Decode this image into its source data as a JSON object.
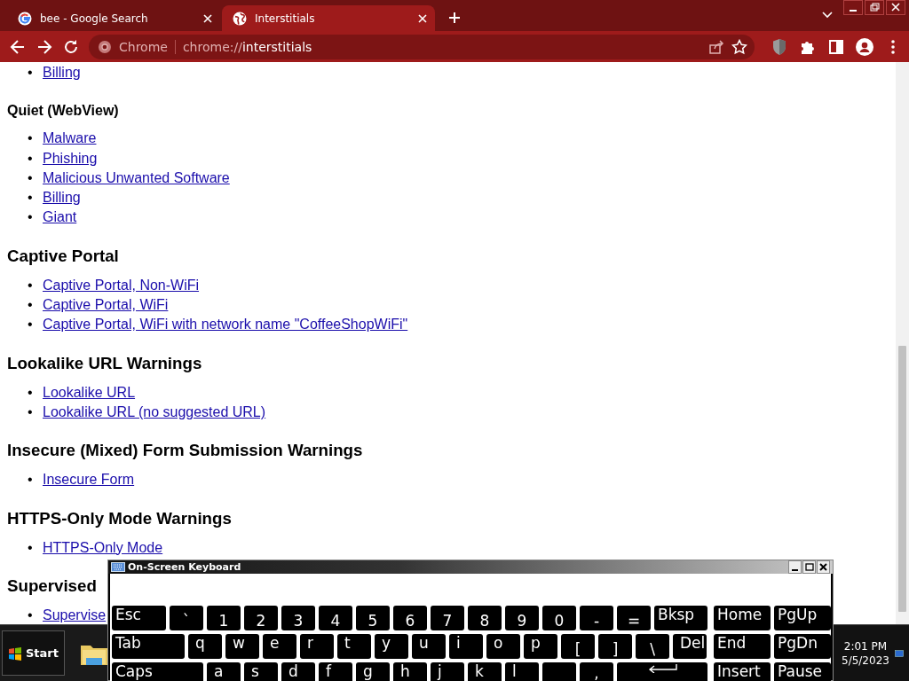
{
  "browser": {
    "tabs": [
      {
        "title": "bee - Google Search",
        "selected": false
      },
      {
        "title": "Interstitials",
        "selected": true
      }
    ],
    "address": {
      "site_label": "Chrome",
      "url_scheme": "chrome://",
      "url_path": "interstitials"
    }
  },
  "page": {
    "blocks": [
      {
        "kind": "list",
        "marker": "•",
        "items": [
          "Billing"
        ]
      },
      {
        "kind": "subheading",
        "text": "Quiet (WebView)"
      },
      {
        "kind": "list",
        "marker": "•",
        "items": [
          "Malware",
          "Phishing",
          "Malicious Unwanted Software",
          "Billing",
          "Giant"
        ]
      },
      {
        "kind": "heading",
        "text": "Captive Portal"
      },
      {
        "kind": "list",
        "marker": "•",
        "items": [
          "Captive Portal, Non-WiFi",
          "Captive Portal, WiFi",
          "Captive Portal, WiFi with network name \"CoffeeShopWiFi\""
        ]
      },
      {
        "kind": "heading",
        "text": "Lookalike URL Warnings"
      },
      {
        "kind": "list",
        "marker": "•",
        "items": [
          "Lookalike URL",
          "Lookalike URL (no suggested URL)"
        ]
      },
      {
        "kind": "heading",
        "text": "Insecure (Mixed) Form Submission Warnings"
      },
      {
        "kind": "list",
        "marker": "•",
        "items": [
          "Insecure Form"
        ]
      },
      {
        "kind": "heading",
        "text": "HTTPS-Only Mode Warnings"
      },
      {
        "kind": "list",
        "marker": "•",
        "items": [
          "HTTPS-Only Mode"
        ]
      },
      {
        "kind": "heading",
        "text": "Supervised"
      },
      {
        "kind": "list",
        "marker": "•",
        "items": [
          "Supervise"
        ]
      }
    ]
  },
  "keyboard": {
    "title": "On-Screen Keyboard",
    "rows": [
      [
        {
          "label": "Esc",
          "kind": "esc"
        },
        {
          "label": "`",
          "kind": "char"
        },
        {
          "label": "1",
          "kind": "char"
        },
        {
          "label": "2",
          "kind": "char"
        },
        {
          "label": "3",
          "kind": "char"
        },
        {
          "label": "4",
          "kind": "char"
        },
        {
          "label": "5",
          "kind": "char"
        },
        {
          "label": "6",
          "kind": "char"
        },
        {
          "label": "7",
          "kind": "char"
        },
        {
          "label": "8",
          "kind": "char"
        },
        {
          "label": "9",
          "kind": "char"
        },
        {
          "label": "0",
          "kind": "char"
        },
        {
          "label": "-",
          "kind": "char"
        },
        {
          "label": "=",
          "kind": "char"
        },
        {
          "label": "Bksp",
          "kind": "back"
        }
      ],
      [
        {
          "label": "Tab",
          "kind": "tab"
        },
        {
          "label": "q",
          "kind": "letter"
        },
        {
          "label": "w",
          "kind": "letter"
        },
        {
          "label": "e",
          "kind": "letter"
        },
        {
          "label": "r",
          "kind": "letter"
        },
        {
          "label": "t",
          "kind": "letter"
        },
        {
          "label": "y",
          "kind": "letter"
        },
        {
          "label": "u",
          "kind": "letter"
        },
        {
          "label": "i",
          "kind": "letter"
        },
        {
          "label": "o",
          "kind": "letter"
        },
        {
          "label": "p",
          "kind": "letter"
        },
        {
          "label": "[",
          "kind": "char"
        },
        {
          "label": "]",
          "kind": "char"
        },
        {
          "label": "\\",
          "kind": "char"
        },
        {
          "label": "Del",
          "kind": "letter"
        }
      ],
      [
        {
          "label": "Caps",
          "kind": "caps"
        },
        {
          "label": "a",
          "kind": "letter"
        },
        {
          "label": "s",
          "kind": "letter"
        },
        {
          "label": "d",
          "kind": "letter"
        },
        {
          "label": "f",
          "kind": "letter"
        },
        {
          "label": "g",
          "kind": "letter"
        },
        {
          "label": "h",
          "kind": "letter"
        },
        {
          "label": "j",
          "kind": "letter"
        },
        {
          "label": "k",
          "kind": "letter"
        },
        {
          "label": "l",
          "kind": "letter"
        },
        {
          "kind": "blank"
        },
        {
          "label": ",",
          "kind": "punct"
        },
        {
          "kind": "enter"
        }
      ]
    ],
    "nav_rows": [
      [
        {
          "label": "Home",
          "kind": "nav"
        },
        {
          "label": "PgUp",
          "kind": "nav"
        }
      ],
      [
        {
          "label": "End",
          "kind": "nav"
        },
        {
          "label": "PgDn",
          "kind": "nav"
        }
      ],
      [
        {
          "label": "Insert",
          "kind": "nav"
        },
        {
          "label": "Pause",
          "kind": "nav"
        }
      ]
    ]
  },
  "taskbar": {
    "start_label": "Start",
    "clock": {
      "time": "2:01 PM",
      "date": "5/5/2023"
    }
  }
}
